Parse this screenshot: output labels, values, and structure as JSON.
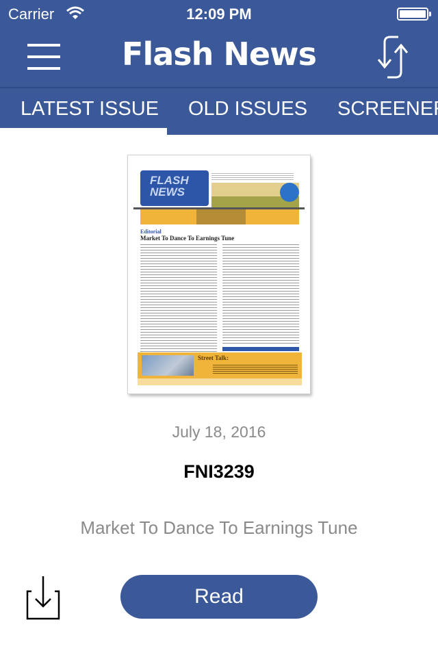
{
  "status_bar": {
    "carrier": "Carrier",
    "time": "12:09 PM",
    "wifi_icon": "wifi-icon",
    "battery_icon": "battery-full-icon"
  },
  "navbar": {
    "title": "Flash News",
    "menu_icon": "hamburger-menu-icon",
    "sync_icon": "sync-arrows-icon"
  },
  "tabs": [
    {
      "label": "LATEST ISSUE",
      "active": true
    },
    {
      "label": "OLD ISSUES",
      "active": false
    },
    {
      "label": "SCREENER",
      "active": false
    }
  ],
  "issue": {
    "thumbnail": {
      "masthead": "FLASH NEWS",
      "section": "Editorial",
      "headline": "Market To Dance To Earnings Tune",
      "street_talk": "Street Talk:"
    },
    "date": "July 18, 2016",
    "code": "FNI3239",
    "headline": "Market To Dance To Earnings Tune",
    "download_icon": "download-icon",
    "read_label": "Read"
  },
  "colors": {
    "brand": "#3b5998",
    "muted_text": "#8a8a8a"
  }
}
